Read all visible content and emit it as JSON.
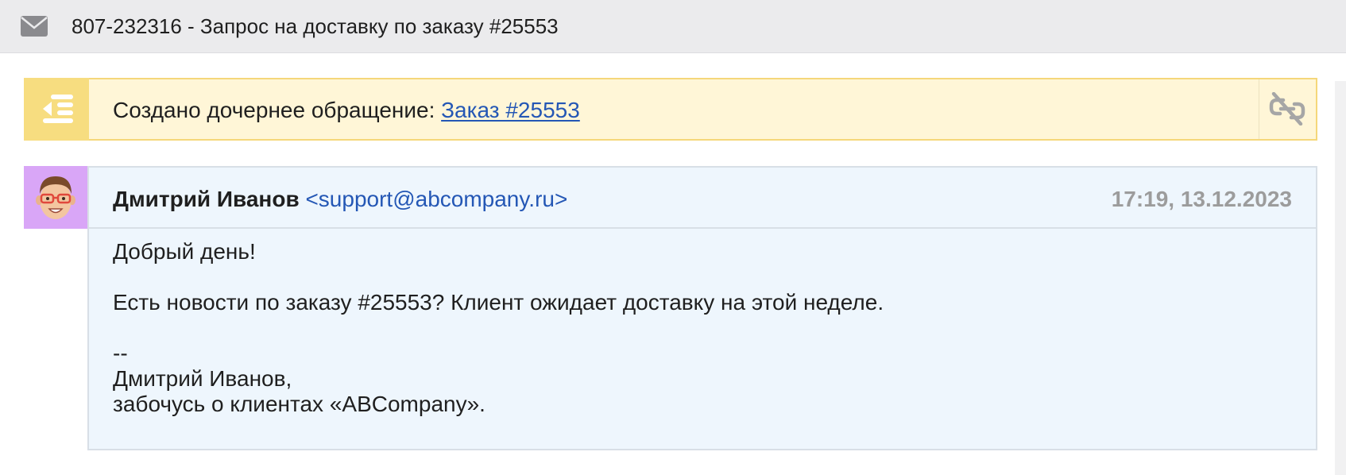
{
  "topbar": {
    "icon": "envelope-icon",
    "title": "807-232316 - Запрос на доставку по заказу #25553"
  },
  "notice": {
    "icon": "outdent-list-icon",
    "text": "Создано дочернее обращение: ",
    "link_label": "Заказ #25553",
    "action_icon": "unlink-icon",
    "colors": {
      "background": "#fff6d7",
      "border": "#f5d77a",
      "badge": "#f7dd80"
    }
  },
  "message": {
    "avatar_icon": "memoji-avatar-icon",
    "sender_name": "Дмитрий Иванов",
    "sender_email": "<support@abcompany.ru>",
    "datetime": "17:19, 13.12.2023",
    "body": {
      "greeting": "Добрый день!",
      "text": "Есть новости по заказу #25553? Клиент ожидает доставку на этой неделе.",
      "sig_separator": "--",
      "sig_name": "Дмитрий Иванов,",
      "sig_tagline": "забочусь о клиентах «ABCompany»."
    },
    "colors": {
      "background": "#eef6fd",
      "avatar_bg": "#d9a6f7",
      "link": "#2457b5"
    }
  }
}
